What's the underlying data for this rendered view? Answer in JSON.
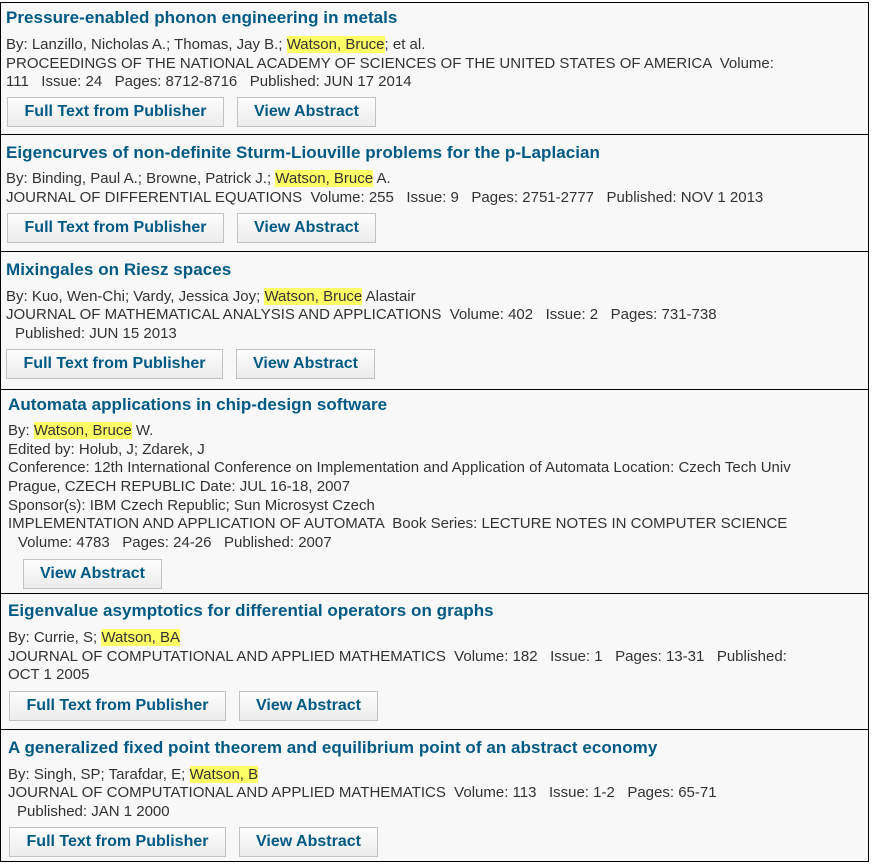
{
  "buttons": {
    "full_text": "Full Text from Publisher",
    "view_abstract": "View Abstract"
  },
  "highlight_color": "#ffff66",
  "title_color": "#005a84",
  "records": [
    {
      "title": "Pressure-enabled phonon engineering in metals",
      "by_prefix": "By: Lanzillo, Nicholas A.; Thomas, Jay B.; ",
      "by_highlight": "Watson, Bruce",
      "by_suffix": "; et al.",
      "source_line1": "PROCEEDINGS OF THE NATIONAL ACADEMY OF SCIENCES OF THE UNITED STATES OF AMERICA  Volume:",
      "source_line2": "111   Issue: 24   Pages: 8712-8716   Published: JUN 17 2014"
    },
    {
      "title": "Eigencurves of non-definite Sturm-Liouville problems for the p-Laplacian",
      "by_prefix": "By: Binding, Paul A.; Browne, Patrick J.; ",
      "by_highlight": "Watson, Bruce",
      "by_suffix": " A.",
      "source_line1": "JOURNAL OF DIFFERENTIAL EQUATIONS  Volume: 255   Issue: 9   Pages: 2751-2777   Published: NOV 1 2013"
    },
    {
      "title": "Mixingales on Riesz spaces",
      "by_prefix": "By: Kuo, Wen-Chi; Vardy, Jessica Joy; ",
      "by_highlight": "Watson, Bruce",
      "by_suffix": " Alastair",
      "source_line1": "JOURNAL OF MATHEMATICAL ANALYSIS AND APPLICATIONS  Volume: 402   Issue: 2   Pages: 731-738",
      "source_line2": "Published: JUN 15 2013"
    },
    {
      "title": "Automata applications in chip-design software",
      "by_prefix": "By: ",
      "by_highlight": "Watson, Bruce",
      "by_suffix": " W.",
      "edited_by": "Edited by: Holub, J; Zdarek, J",
      "conference_line1": "Conference: 12th International Conference on Implementation and Application of Automata Location: Czech Tech Univ",
      "conference_line2": "Prague, CZECH REPUBLIC Date: JUL 16-18, 2007",
      "sponsors": "Sponsor(s): IBM Czech Republic; Sun Microsyst Czech",
      "source_line1": "IMPLEMENTATION AND APPLICATION OF AUTOMATA  Book Series: LECTURE NOTES IN COMPUTER SCIENCE",
      "source_line2": "Volume: 4783   Pages: 24-26   Published: 2007"
    },
    {
      "title": "Eigenvalue asymptotics for differential operators on graphs",
      "by_prefix": "By: Currie, S; ",
      "by_highlight": "Watson, BA",
      "by_suffix": "",
      "source_line1": "JOURNAL OF COMPUTATIONAL AND APPLIED MATHEMATICS  Volume: 182   Issue: 1   Pages: 13-31   Published:",
      "source_line2": "OCT 1 2005"
    },
    {
      "title": "A generalized fixed point theorem and equilibrium point of an abstract economy",
      "by_prefix": "By: Singh, SP; Tarafdar, E; ",
      "by_highlight": "Watson, B",
      "by_suffix": "",
      "source_line1": "JOURNAL OF COMPUTATIONAL AND APPLIED MATHEMATICS  Volume: 113   Issue: 1-2   Pages: 65-71",
      "source_line2": "Published: JAN 1 2000"
    }
  ]
}
